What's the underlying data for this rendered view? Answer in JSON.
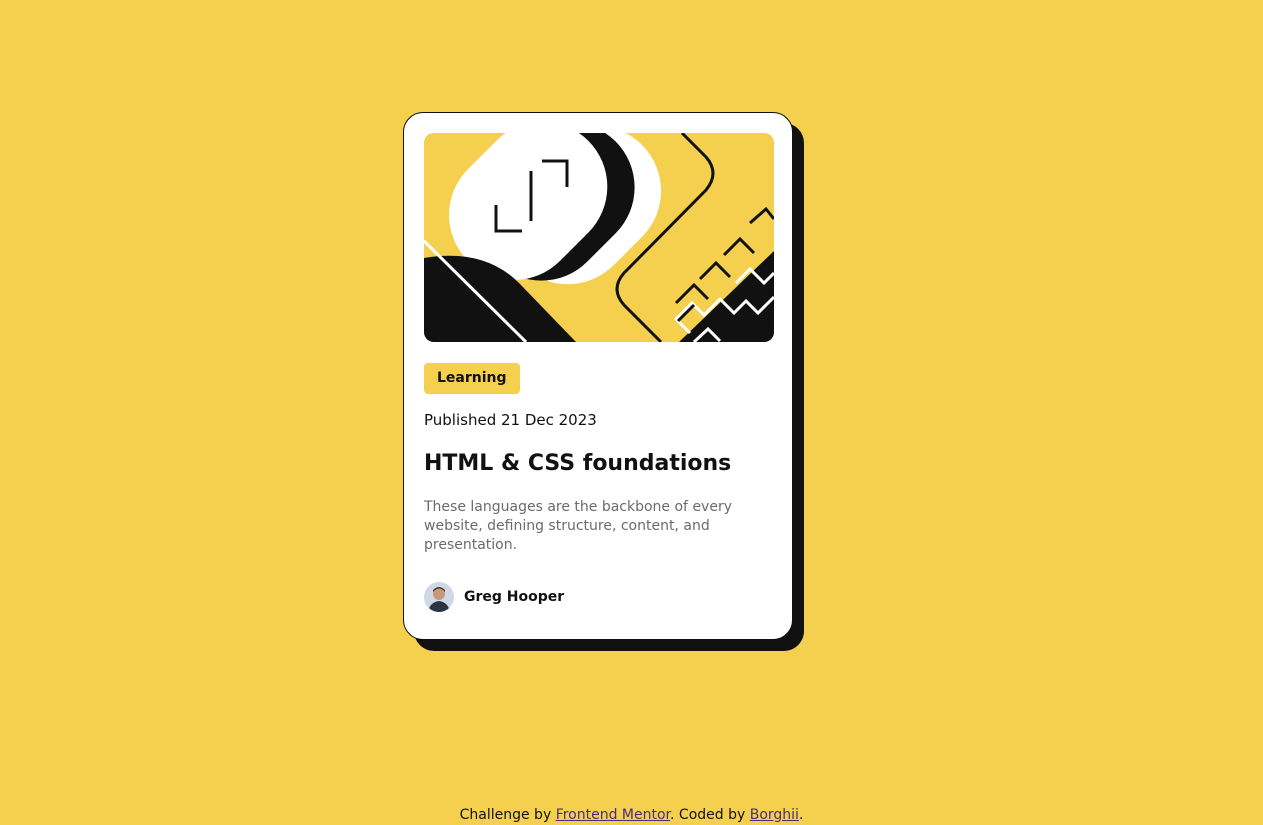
{
  "colors": {
    "background": "#f4d04e",
    "card": "#ffffff",
    "ink": "#111111",
    "muted_text": "#6b6b6b",
    "link": "#4b2b7f"
  },
  "card": {
    "illustration_icon": "abstract-geometric-illustration",
    "tag_label": "Learning",
    "published": "Published 21 Dec 2023",
    "title": "HTML & CSS foundations",
    "description": "These languages are the backbone of every website, defining structure, content, and presentation.",
    "author": {
      "name": "Greg Hooper",
      "avatar_icon": "author-avatar"
    }
  },
  "footer": {
    "prefix": "Challenge by ",
    "mentor_link": "Frontend Mentor",
    "middle": ". Coded by ",
    "author_link": "Borghii",
    "suffix": "."
  }
}
